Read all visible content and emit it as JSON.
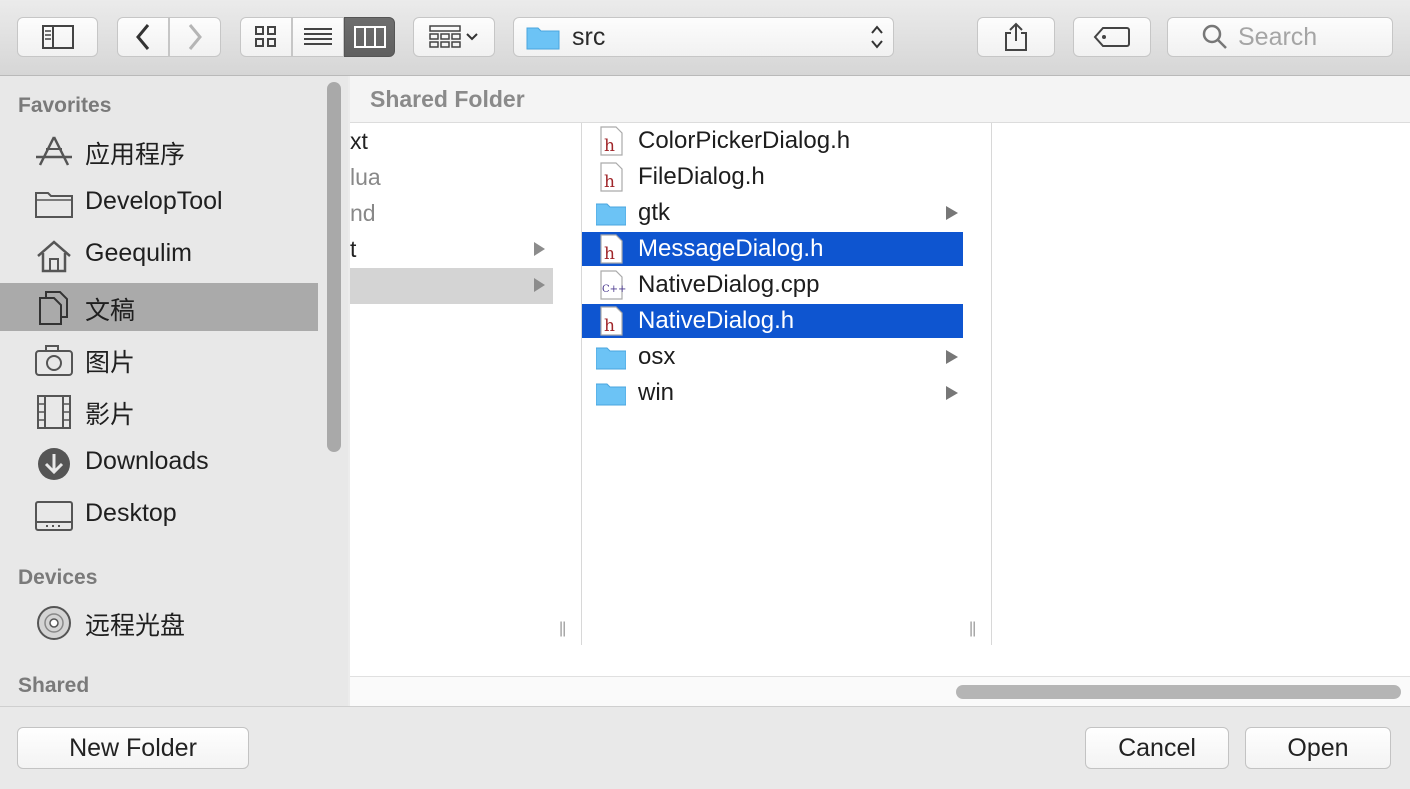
{
  "toolbar": {
    "path_label": "src",
    "search_placeholder": "Search"
  },
  "sidebar": {
    "favorites_header": "Favorites",
    "favorites": [
      {
        "label": "应用程序",
        "icon": "applications-icon"
      },
      {
        "label": "DevelopTool",
        "icon": "folder-icon"
      },
      {
        "label": "Geequlim",
        "icon": "home-icon"
      },
      {
        "label": "文稿",
        "icon": "documents-icon",
        "selected": true
      },
      {
        "label": "图片",
        "icon": "camera-icon"
      },
      {
        "label": "影片",
        "icon": "film-icon"
      },
      {
        "label": "Downloads",
        "icon": "downloads-icon"
      },
      {
        "label": "Desktop",
        "icon": "desktop-icon"
      }
    ],
    "devices_header": "Devices",
    "devices": [
      {
        "label": "远程光盘",
        "icon": "disc-icon"
      }
    ],
    "shared_header": "Shared"
  },
  "browser": {
    "header_title": "Shared Folder",
    "col1": [
      {
        "text": "xt"
      },
      {
        "text": "lua"
      },
      {
        "text": "nd"
      },
      {
        "text": "t"
      },
      {
        "text": ""
      }
    ],
    "col2": [
      {
        "label": "ColorPickerDialog.h",
        "kind": "header-file"
      },
      {
        "label": "FileDialog.h",
        "kind": "header-file"
      },
      {
        "label": "gtk",
        "kind": "folder"
      },
      {
        "label": "MessageDialog.h",
        "kind": "header-file",
        "selected": true
      },
      {
        "label": "NativeDialog.cpp",
        "kind": "cpp-file"
      },
      {
        "label": "NativeDialog.h",
        "kind": "header-file",
        "selected": true
      },
      {
        "label": "osx",
        "kind": "folder"
      },
      {
        "label": "win",
        "kind": "folder"
      }
    ],
    "resize_glyph": "||"
  },
  "buttons": {
    "new_folder": "New Folder",
    "cancel": "Cancel",
    "open": "Open"
  },
  "colors": {
    "selection": "#0e55d0",
    "folder": "#6cc3f5",
    "sidebar_selection": "#aaaaaa"
  }
}
